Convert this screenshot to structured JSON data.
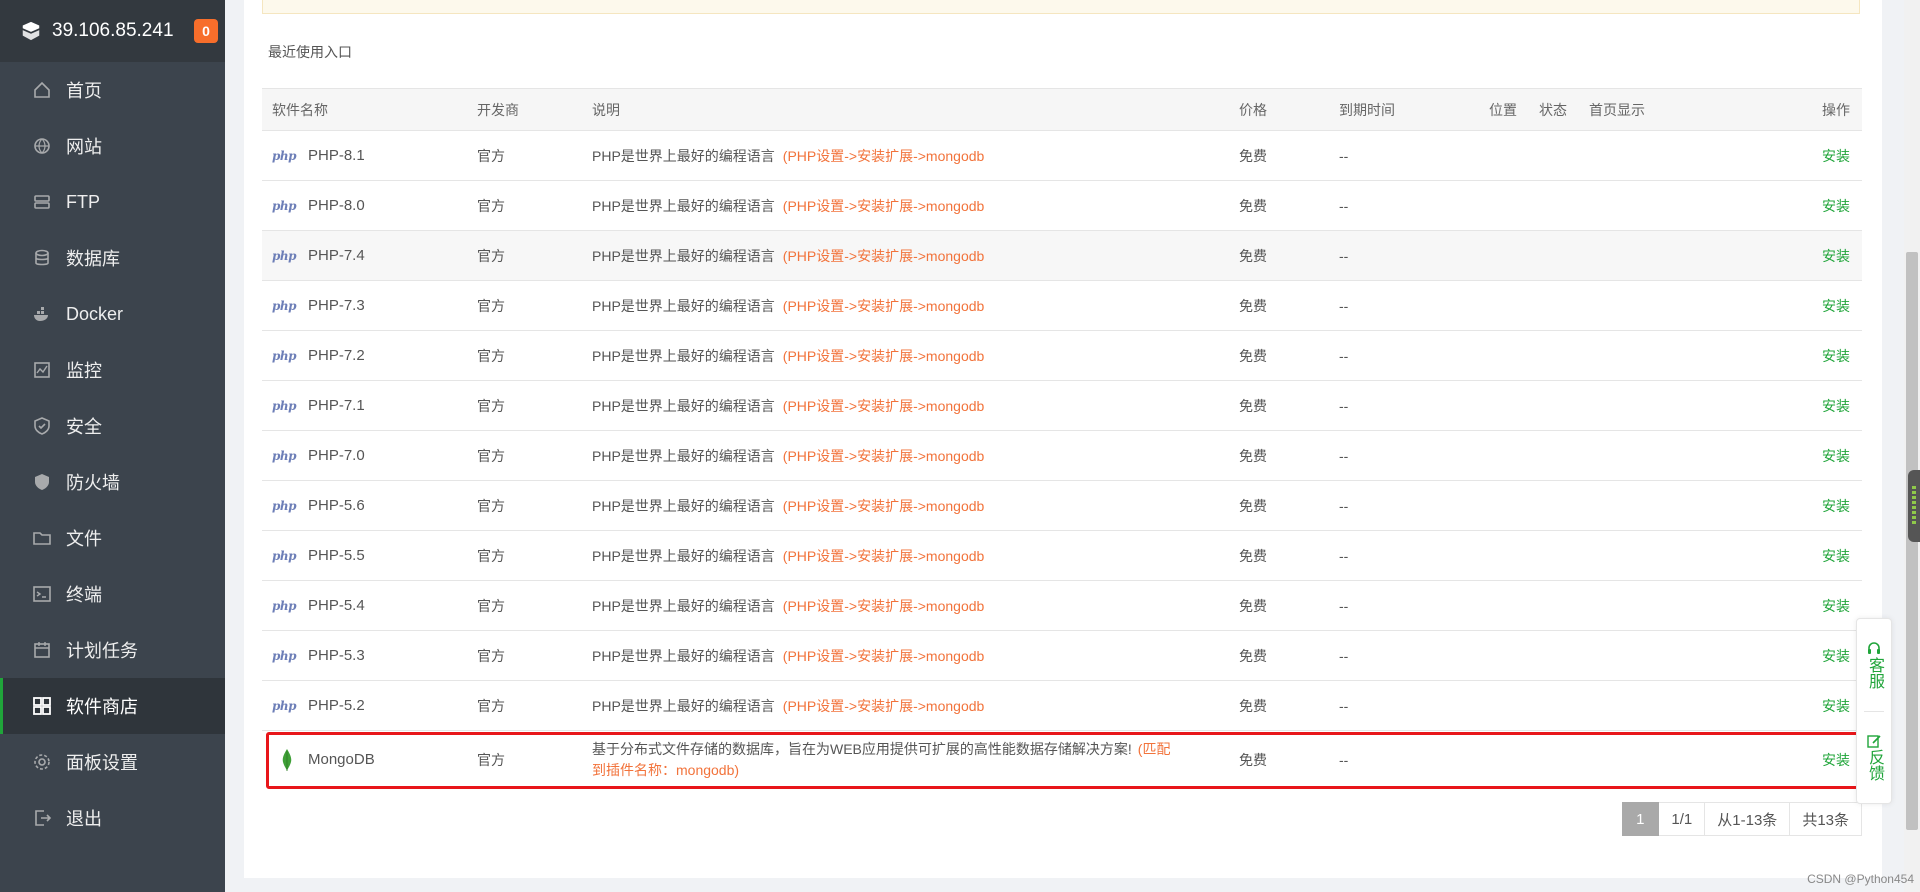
{
  "sidebar": {
    "ip": "39.106.85.241",
    "badge": "0",
    "items": [
      {
        "label": "首页",
        "icon": "home-icon"
      },
      {
        "label": "网站",
        "icon": "globe-icon"
      },
      {
        "label": "FTP",
        "icon": "ftp-icon"
      },
      {
        "label": "数据库",
        "icon": "database-icon"
      },
      {
        "label": "Docker",
        "icon": "docker-icon"
      },
      {
        "label": "监控",
        "icon": "monitor-icon"
      },
      {
        "label": "安全",
        "icon": "shield-check-icon"
      },
      {
        "label": "防火墙",
        "icon": "firewall-icon"
      },
      {
        "label": "文件",
        "icon": "folder-icon"
      },
      {
        "label": "终端",
        "icon": "terminal-icon"
      },
      {
        "label": "计划任务",
        "icon": "calendar-icon"
      },
      {
        "label": "软件商店",
        "icon": "grid-icon"
      },
      {
        "label": "面板设置",
        "icon": "gear-icon"
      },
      {
        "label": "退出",
        "icon": "logout-icon"
      }
    ],
    "active_index": 11
  },
  "main": {
    "recent_label": "最近使用入口",
    "table": {
      "headers": {
        "name": "软件名称",
        "dev": "开发商",
        "desc": "说明",
        "price": "价格",
        "expire": "到期时间",
        "pos": "位置",
        "status": "状态",
        "home": "首页显示",
        "op": "操作"
      },
      "php_desc": "PHP是世界上最好的编程语言",
      "php_hint": "(PHP设置->安装扩展->mongodb",
      "rows": [
        {
          "name": "PHP-8.1",
          "dev": "官方",
          "price": "免费",
          "expire": "--",
          "op": "安装"
        },
        {
          "name": "PHP-8.0",
          "dev": "官方",
          "price": "免费",
          "expire": "--",
          "op": "安装"
        },
        {
          "name": "PHP-7.4",
          "dev": "官方",
          "price": "免费",
          "expire": "--",
          "op": "安装"
        },
        {
          "name": "PHP-7.3",
          "dev": "官方",
          "price": "免费",
          "expire": "--",
          "op": "安装"
        },
        {
          "name": "PHP-7.2",
          "dev": "官方",
          "price": "免费",
          "expire": "--",
          "op": "安装"
        },
        {
          "name": "PHP-7.1",
          "dev": "官方",
          "price": "免费",
          "expire": "--",
          "op": "安装"
        },
        {
          "name": "PHP-7.0",
          "dev": "官方",
          "price": "免费",
          "expire": "--",
          "op": "安装"
        },
        {
          "name": "PHP-5.6",
          "dev": "官方",
          "price": "免费",
          "expire": "--",
          "op": "安装"
        },
        {
          "name": "PHP-5.5",
          "dev": "官方",
          "price": "免费",
          "expire": "--",
          "op": "安装"
        },
        {
          "name": "PHP-5.4",
          "dev": "官方",
          "price": "免费",
          "expire": "--",
          "op": "安装"
        },
        {
          "name": "PHP-5.3",
          "dev": "官方",
          "price": "免费",
          "expire": "--",
          "op": "安装"
        },
        {
          "name": "PHP-5.2",
          "dev": "官方",
          "price": "免费",
          "expire": "--",
          "op": "安装"
        }
      ],
      "mongo": {
        "name": "MongoDB",
        "dev": "官方",
        "desc": "基于分布式文件存储的数据库，旨在为WEB应用提供可扩展的高性能数据存储解决方案!",
        "hint_line1": "(匹配",
        "hint_line2": "到插件名称：mongodb)",
        "price": "免费",
        "expire": "--",
        "op": "安装"
      }
    },
    "pager": {
      "current": "1",
      "pages": "1/1",
      "range": "从1-13条",
      "total": "共13条"
    }
  },
  "float_bar": {
    "service": "客服",
    "feedback": "反馈"
  },
  "watermark": "CSDN @Python454",
  "colors": {
    "accent": "#20a53a",
    "hint": "#f2733b",
    "highlight": "#e8161a",
    "sidebar_bg": "#3c444d",
    "badge": "#f76e2b"
  }
}
